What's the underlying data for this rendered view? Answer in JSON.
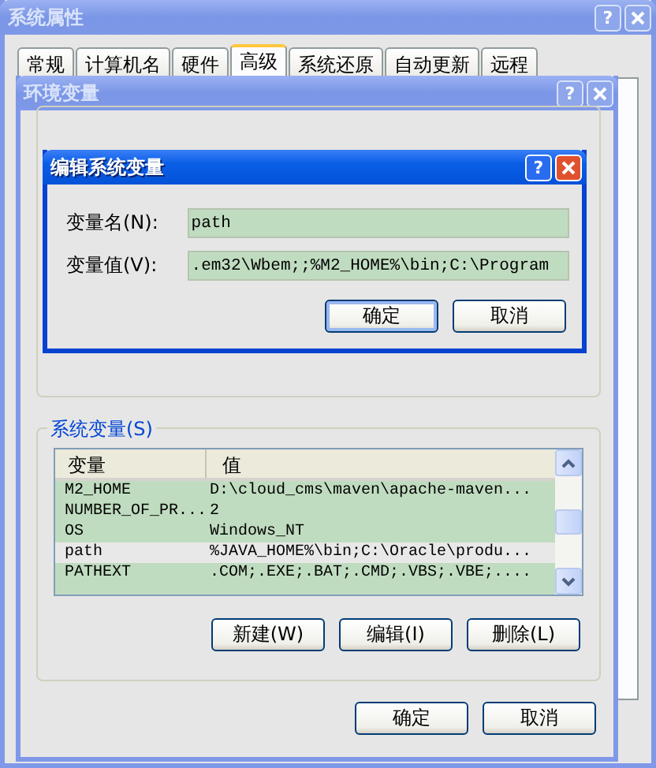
{
  "system_properties": {
    "title": "系统属性",
    "active": false,
    "help": "?",
    "tabs": [
      {
        "label": "常规",
        "selected": false
      },
      {
        "label": "计算机名",
        "selected": false
      },
      {
        "label": "硬件",
        "selected": false
      },
      {
        "label": "高级",
        "selected": true
      },
      {
        "label": "系统还原",
        "selected": false
      },
      {
        "label": "自动更新",
        "selected": false
      },
      {
        "label": "远程",
        "selected": false
      }
    ]
  },
  "environment_variables": {
    "title": "环境变量",
    "active": false,
    "help": "?",
    "system_group": {
      "label": "系统变量(S)",
      "columns": [
        "变量",
        "值"
      ],
      "rows": [
        {
          "name": "M2_HOME",
          "value": "D:\\cloud_cms\\maven\\apache-maven...",
          "selected": false
        },
        {
          "name": "NUMBER_OF_PR...",
          "value": "2",
          "selected": false
        },
        {
          "name": "OS",
          "value": "Windows_NT",
          "selected": false
        },
        {
          "name": "path",
          "value": "%JAVA_HOME%\\bin;C:\\Oracle\\produ...",
          "selected": true
        },
        {
          "name": "PATHEXT",
          "value": ".COM;.EXE;.BAT;.CMD;.VBS;.VBE;....",
          "selected": false
        }
      ],
      "buttons": [
        "新建(W)",
        "编辑(I)",
        "删除(L)"
      ]
    },
    "buttons": [
      "确定",
      "取消"
    ]
  },
  "edit_dialog": {
    "title": "编辑系统变量",
    "active": true,
    "help": "?",
    "fields": [
      {
        "label": "变量名(N):",
        "value": "path"
      },
      {
        "label": "变量值(V):",
        "value": ".em32\\Wbem;;%M2_HOME%\\bin;C:\\Program"
      }
    ],
    "buttons": [
      {
        "label": "确定",
        "default": true
      },
      {
        "label": "取消",
        "default": false
      }
    ]
  }
}
